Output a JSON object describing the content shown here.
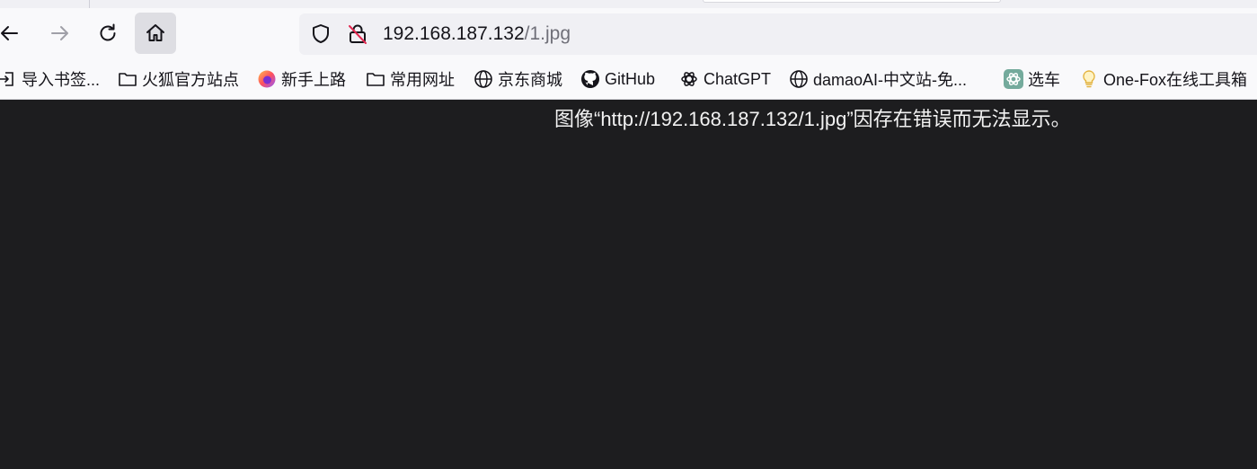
{
  "tabs": {},
  "nav": {
    "back_icon": "arrow-left-icon",
    "forward_icon": "arrow-right-icon",
    "reload_icon": "reload-icon",
    "home_icon": "home-icon"
  },
  "urlbar": {
    "host": "192.168.187.132",
    "path": "/1.jpg",
    "tracking_icon": "shield-icon",
    "security_icon": "insecure-lock-icon"
  },
  "bookmarks": [
    {
      "label": "导入书签...",
      "icon": "import-icon"
    },
    {
      "label": "火狐官方站点",
      "icon": "folder-icon"
    },
    {
      "label": "新手上路",
      "icon": "firefox-icon"
    },
    {
      "label": "常用网址",
      "icon": "folder-icon"
    },
    {
      "label": "京东商城",
      "icon": "globe-icon"
    },
    {
      "label": "GitHub",
      "icon": "github-icon"
    },
    {
      "label": "ChatGPT",
      "icon": "chatgpt-icon"
    },
    {
      "label": "damaoAI-中文站-免...",
      "icon": "globe-icon"
    },
    {
      "label": "选车",
      "icon": "chatgpt-icon"
    },
    {
      "label": "One-Fox在线工具箱",
      "icon": "bulb-icon"
    }
  ],
  "content": {
    "error_message": "图像“http://192.168.187.132/1.jpg”因存在错误而无法显示。"
  },
  "colors": {
    "toolbar_bg": "#f9f9fb",
    "urlbar_bg": "#f0f0f4",
    "content_bg": "#1d1d1f",
    "error_text": "#f2f2f2"
  }
}
